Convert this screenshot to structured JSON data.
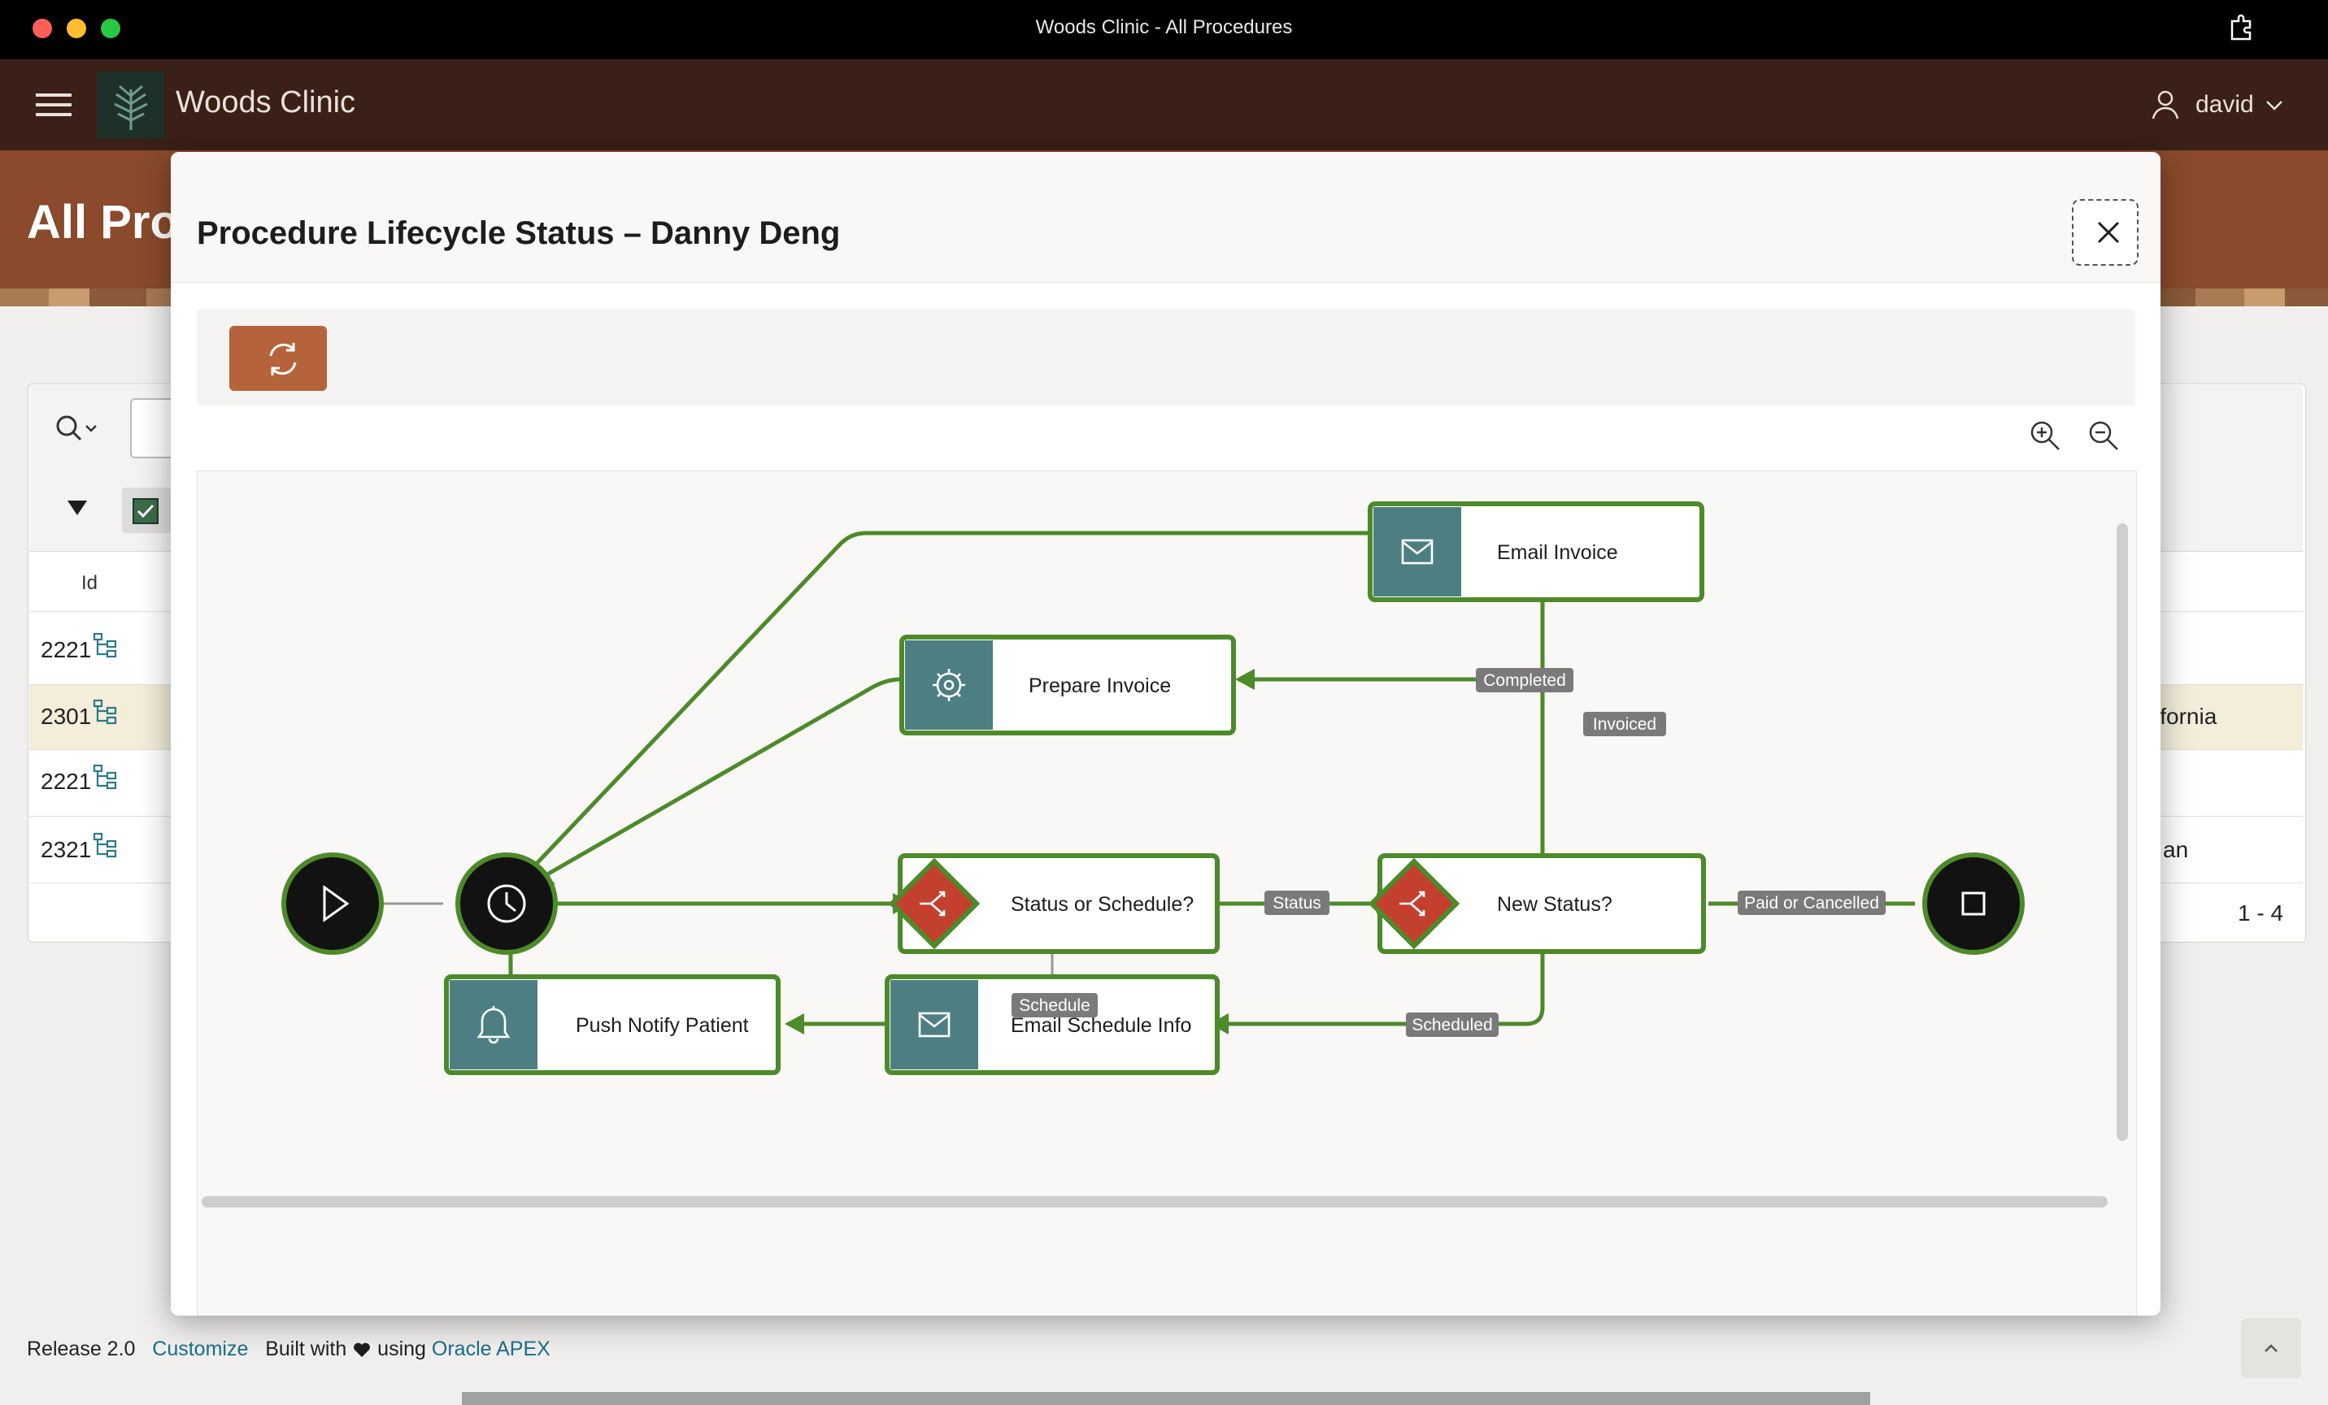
{
  "window": {
    "title": "Woods Clinic - All Procedures"
  },
  "app": {
    "name": "Woods Clinic",
    "user": "david"
  },
  "page": {
    "title": "All Procedures",
    "title_visible": "All Pro",
    "column_id": "Id",
    "rows": [
      {
        "id": "2221"
      },
      {
        "id": "2301",
        "right_text": "ifornia"
      },
      {
        "id": "2221"
      },
      {
        "id": "2321",
        "right_text": "an"
      }
    ],
    "pagination": "1 - 4"
  },
  "footer": {
    "release": "Release 2.0",
    "customize": "Customize",
    "built_with": "Built with",
    "using": "using",
    "oracle_apex": "Oracle APEX"
  },
  "modal": {
    "title": "Procedure Lifecycle Status – Danny Deng"
  },
  "diagram": {
    "nodes": {
      "email_invoice": "Email Invoice",
      "prepare_invoice": "Prepare Invoice",
      "status_or_schedule": "Status or Schedule?",
      "new_status": "New Status?",
      "push_notify": "Push Notify Patient",
      "email_schedule": "Email Schedule Info"
    },
    "edges": {
      "completed": "Completed",
      "invoiced": "Invoiced",
      "status": "Status",
      "paid_or_cancelled": "Paid or Cancelled",
      "schedule": "Schedule",
      "scheduled": "Scheduled"
    }
  },
  "colors": {
    "titlebar": "#000000",
    "header": "#3a2017",
    "accent_button": "#b5633a",
    "flow_green": "#4d8a2a",
    "task_teal": "#4d7f82",
    "gateway_red": "#c4402e",
    "edge_label_bg": "#7a7a7a"
  }
}
